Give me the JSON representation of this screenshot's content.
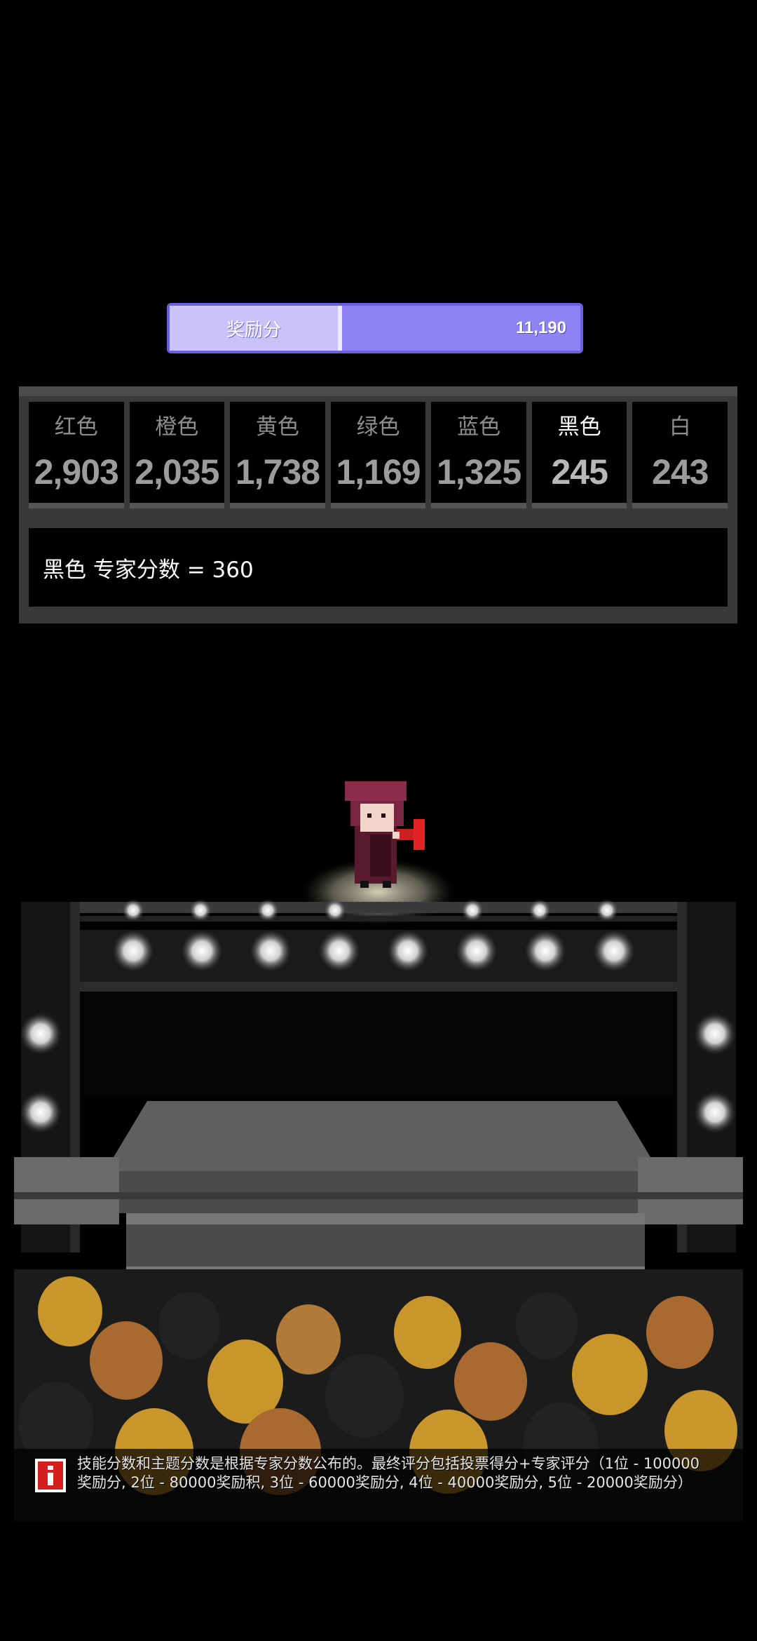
{
  "bonus": {
    "label": "奖励分",
    "value": "11,190"
  },
  "scores": [
    {
      "name": "红色",
      "value": "2,903",
      "active": false
    },
    {
      "name": "橙色",
      "value": "2,035",
      "active": false
    },
    {
      "name": "黄色",
      "value": "1,738",
      "active": false
    },
    {
      "name": "绿色",
      "value": "1,169",
      "active": false
    },
    {
      "name": "蓝色",
      "value": "1,325",
      "active": false
    },
    {
      "name": "黑色",
      "value": "245",
      "active": true
    },
    {
      "name": "白",
      "value": "243",
      "active": false
    }
  ],
  "expert_line": "黑色 专家分数 = 360",
  "info": {
    "icon": "info-icon",
    "text": "技能分数和主题分数是根据专家分数公布的。最终评分包括投票得分+专家评分（1位 - 100000奖励分, 2位 - 80000奖励积, 3位 - 60000奖励分, 4位 - 40000奖励分, 5位 - 20000奖励分）"
  },
  "colors": {
    "bonus_bar": "#8f82f4",
    "bonus_label_bg": "#c9c2fb",
    "panel": "#3a3a3a",
    "info_icon": "#d61f1f"
  }
}
